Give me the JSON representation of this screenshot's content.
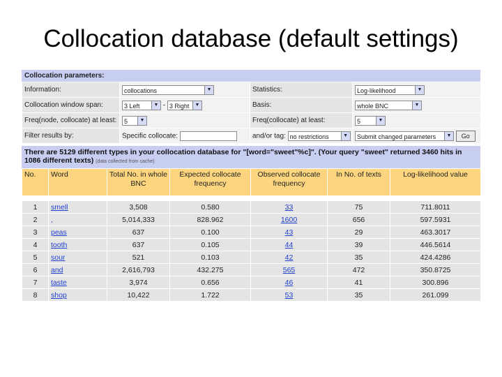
{
  "slide": {
    "title": "Collocation database (default settings)"
  },
  "params": {
    "heading": "Collocation parameters:",
    "information_label": "Information:",
    "information_value": "collocations",
    "statistics_label": "Statistics:",
    "statistics_value": "Log-likelihood",
    "window_label": "Collocation window span:",
    "window_left": "3 Left",
    "window_dash": "-",
    "window_right": "3 Right",
    "basis_label": "Basis:",
    "basis_value": "whole BNC",
    "freq_node_label": "Freq(node, collocate) at least:",
    "freq_node_value": "5",
    "freq_collocate_label": "Freq(collocate) at least:",
    "freq_collocate_value": "5",
    "filter_label": "Filter results by:",
    "specific_label": "Specific collocate:",
    "specific_value": "",
    "andor_label": "and/or tag:",
    "tag_value": "no restrictions",
    "submit_value": "Submit changed parameters",
    "go_label": "Go"
  },
  "summary": {
    "text": "There are 5129 different types in your collocation database for \"[word=\"sweet\"%c]\". (Your query \"sweet\" returned 3460 hits in 1086 different texts)",
    "note": "(data collected from cache)"
  },
  "results": {
    "headers": [
      "No.",
      "Word",
      "Total No. in whole BNC",
      "Expected collocate frequency",
      "Observed collocate frequency",
      "In No. of texts",
      "Log-likelihood value"
    ],
    "rows": [
      [
        "1",
        "smell",
        "3,508",
        "0.580",
        "33",
        "75",
        "711.8011"
      ],
      [
        "2",
        ",",
        "5,014,333",
        "828.962",
        "1600",
        "656",
        "597.5931"
      ],
      [
        "3",
        "peas",
        "637",
        "0.100",
        "43",
        "29",
        "463.3017"
      ],
      [
        "4",
        "tooth",
        "637",
        "0.105",
        "44",
        "39",
        "446.5614"
      ],
      [
        "5",
        "sour",
        "521",
        "0.103",
        "42",
        "35",
        "424.4286"
      ],
      [
        "6",
        "and",
        "2,616,793",
        "432.275",
        "565",
        "472",
        "350.8725"
      ],
      [
        "7",
        "taste",
        "3,974",
        "0.656",
        "46",
        "41",
        "300.896"
      ],
      [
        "8",
        "shop",
        "10,422",
        "1.722",
        "53",
        "35",
        "261.099"
      ]
    ]
  }
}
